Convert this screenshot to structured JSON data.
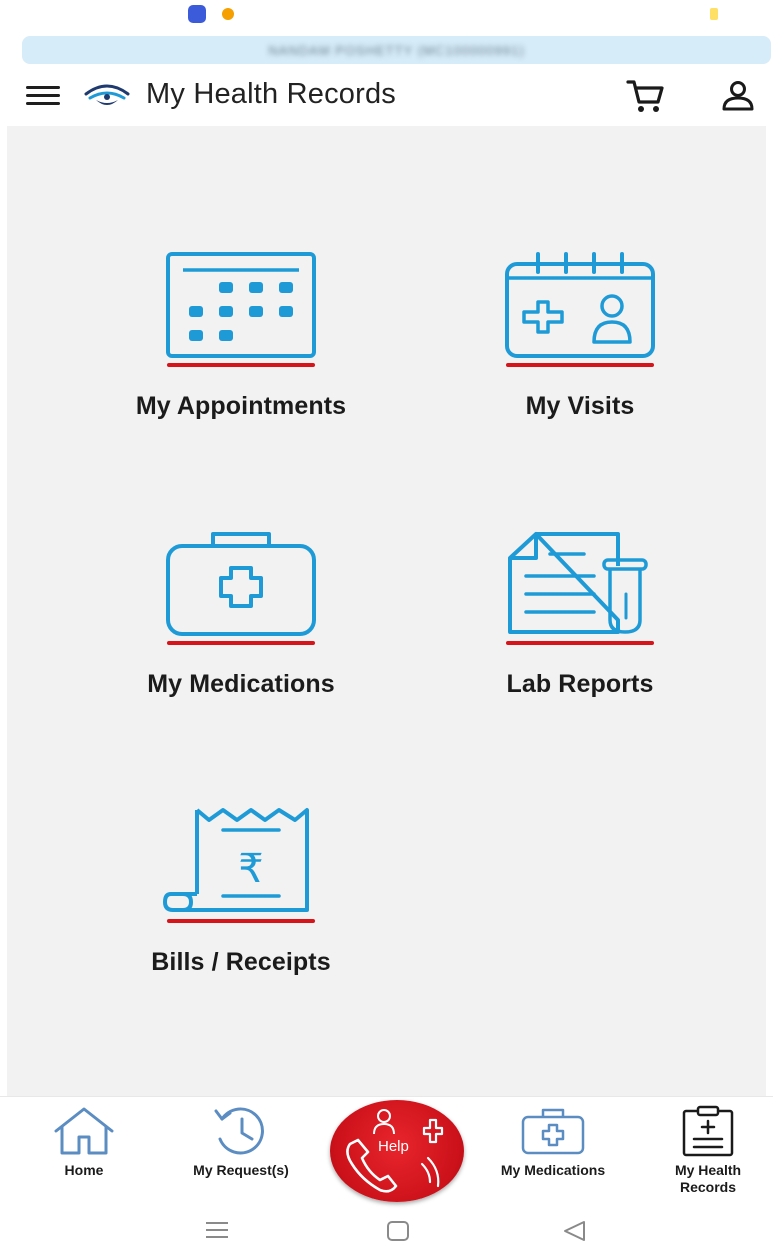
{
  "user_banner": {
    "name": "NANDAM POSHETTY (MC100000991)"
  },
  "header": {
    "title": "My Health Records"
  },
  "tiles": [
    {
      "label": "My Appointments"
    },
    {
      "label": "My Visits"
    },
    {
      "label": "My Medications"
    },
    {
      "label": "Lab Reports"
    },
    {
      "label": "Bills / Receipts"
    }
  ],
  "bottom_nav": {
    "items": [
      {
        "label": "Home",
        "icon": "home-icon"
      },
      {
        "label": "My Request(s)",
        "icon": "history-icon"
      },
      {
        "label": "Help",
        "icon": "help-call-icon"
      },
      {
        "label": "My Medications",
        "icon": "medical-kit-icon"
      },
      {
        "label": "My Health",
        "label2": "Records",
        "icon": "clipboard-icon"
      }
    ]
  },
  "colors": {
    "icon_blue": "#1e9bd7",
    "underline_red": "#d7141a",
    "help_red": "#d7141a",
    "content_bg": "#f2f2f2"
  }
}
